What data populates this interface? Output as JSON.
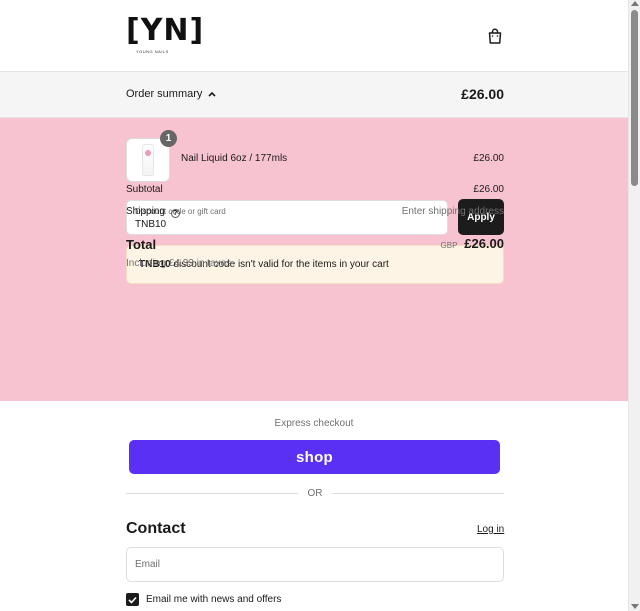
{
  "header": {
    "logo_mark": "[YN]",
    "logo_tagline": "YOUNG NAILS",
    "cart_icon": "shopping-bag-icon"
  },
  "summary_bar": {
    "toggle_label": "Order summary",
    "toggle_icon": "chevron-up-icon",
    "total": "£26.00"
  },
  "order": {
    "items": [
      {
        "name": "Nail Liquid 6oz / 177mls",
        "price": "£26.00",
        "quantity": "1"
      }
    ],
    "discount": {
      "label": "Discount code or gift card",
      "value": "TNB10",
      "apply_label": "Apply"
    },
    "error": {
      "code": "TNB10",
      "message": " discount code isn't valid for the items in your cart"
    },
    "subtotal_label": "Subtotal",
    "subtotal_value": "£26.00",
    "shipping_label": "Shipping",
    "shipping_value": "Enter shipping address",
    "total_label": "Total",
    "currency": "GBP",
    "total_value": "£26.00",
    "tax_note": "Including £4.33 in taxes"
  },
  "express": {
    "label": "Express checkout",
    "shop_label": "shop",
    "or_label": "OR"
  },
  "contact": {
    "title": "Contact",
    "login_label": "Log in",
    "email_placeholder": "Email",
    "optin_label": "Email me with news and offers",
    "optin_checked": true
  },
  "colors": {
    "panel_pink": "#f8c3d0",
    "shop_purple": "#5a31f4",
    "error_bg": "#fef4e6",
    "dark_button": "#1c1c1c"
  }
}
